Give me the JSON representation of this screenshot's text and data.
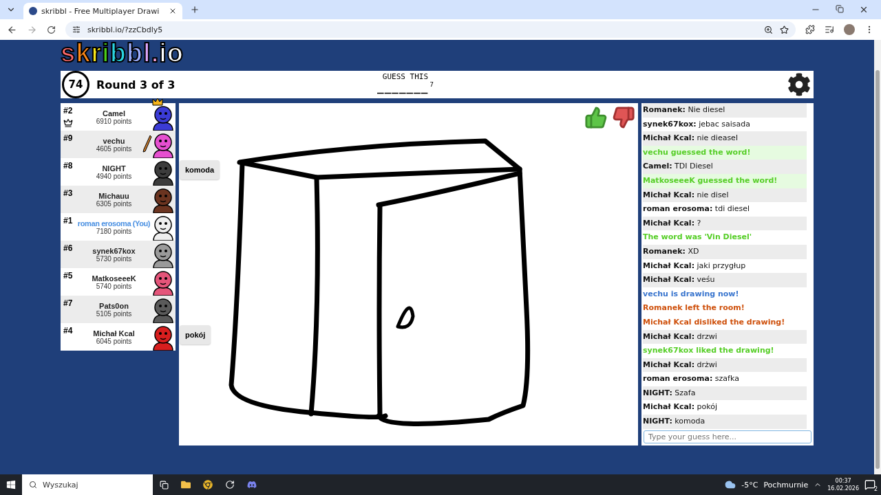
{
  "browser": {
    "tab_title": "skribbl - Free Multiplayer Drawi",
    "url": "skribbl.io/?zzCbdly5"
  },
  "logo": {
    "text": "skribbl.io"
  },
  "header": {
    "timer": "74",
    "round": "Round 3 of 3",
    "prompt": "GUESS THIS",
    "hint": "_______",
    "hint_length": "7"
  },
  "players": [
    {
      "rank": "#2",
      "name": "Camel",
      "points": "6910 points",
      "color": "#3b3bd6",
      "owner": true,
      "crowned": true,
      "drawing": false,
      "you": false
    },
    {
      "rank": "#9",
      "name": "vechu",
      "points": "4605 points",
      "color": "#e64fd0",
      "owner": false,
      "crowned": false,
      "drawing": true,
      "you": false
    },
    {
      "rank": "#8",
      "name": "NIGHT",
      "points": "4940 points",
      "color": "#3c3c3c",
      "owner": false,
      "crowned": false,
      "drawing": false,
      "you": false,
      "bubble": "komoda"
    },
    {
      "rank": "#3",
      "name": "Michauu",
      "points": "6305 points",
      "color": "#6b3420",
      "owner": false,
      "crowned": false,
      "drawing": false,
      "you": false
    },
    {
      "rank": "#1",
      "name": "roman erosoma (You)",
      "points": "7180 points",
      "color": "#eeeeee",
      "owner": false,
      "crowned": false,
      "drawing": false,
      "you": true
    },
    {
      "rank": "#6",
      "name": "synek67kox",
      "points": "5730 points",
      "color": "#9a9a9a",
      "owner": false,
      "crowned": false,
      "drawing": false,
      "you": false
    },
    {
      "rank": "#5",
      "name": "MatkoseeeK",
      "points": "5740 points",
      "color": "#e4557a",
      "owner": false,
      "crowned": false,
      "drawing": false,
      "you": false
    },
    {
      "rank": "#7",
      "name": "Pats0on",
      "points": "5105 points",
      "color": "#5a5a5a",
      "owner": false,
      "crowned": false,
      "drawing": false,
      "you": false
    },
    {
      "rank": "#4",
      "name": "Michał Kcal",
      "points": "6045 points",
      "color": "#d81e1e",
      "owner": false,
      "crowned": false,
      "drawing": false,
      "you": false,
      "bubble": "pokój"
    }
  ],
  "chat": {
    "messages": [
      {
        "kind": "message",
        "author": "Romanek:",
        "text": "Nie diesel"
      },
      {
        "kind": "message",
        "author": "synek67kox:",
        "text": "jebac saisada"
      },
      {
        "kind": "message",
        "author": "Michał Kcal:",
        "text": "nie dieasel"
      },
      {
        "kind": "guessed",
        "text": "vechu guessed the word!"
      },
      {
        "kind": "message",
        "author": "Camel:",
        "text": "TDI Diesel"
      },
      {
        "kind": "guessed",
        "text": "MatkoseeeK guessed the word!"
      },
      {
        "kind": "message",
        "author": "Michał Kcal:",
        "text": "nie disel"
      },
      {
        "kind": "message",
        "author": "roman erosoma:",
        "text": "tdi diesel"
      },
      {
        "kind": "message",
        "author": "Michał Kcal:",
        "text": "?"
      },
      {
        "kind": "success",
        "text": "The word was 'Vin Diesel'"
      },
      {
        "kind": "message",
        "author": "Romanek:",
        "text": "XD"
      },
      {
        "kind": "message",
        "author": "Michał Kcal:",
        "text": "jaki przygłup"
      },
      {
        "kind": "message",
        "author": "Michał Kcal:",
        "text": "veśu"
      },
      {
        "kind": "info",
        "text": "vechu is drawing now!"
      },
      {
        "kind": "warning",
        "text": "Romanek left the room!"
      },
      {
        "kind": "warning",
        "text": "Michał Kcal disliked the drawing!"
      },
      {
        "kind": "message",
        "author": "Michał Kcal:",
        "text": "drzwi"
      },
      {
        "kind": "success",
        "text": "synek67kox liked the drawing!"
      },
      {
        "kind": "message",
        "author": "Michał Kcal:",
        "text": "drżwi"
      },
      {
        "kind": "message",
        "author": "roman erosoma:",
        "text": "szafka"
      },
      {
        "kind": "message",
        "author": "NIGHT:",
        "text": "Szafa"
      },
      {
        "kind": "message",
        "author": "Michał Kcal:",
        "text": "pokój"
      },
      {
        "kind": "message",
        "author": "NIGHT:",
        "text": "komoda"
      }
    ],
    "placeholder": "Type your guess here..."
  },
  "taskbar": {
    "search": "Wyszukaj",
    "temperature": "-5°C",
    "weather": "Pochmurnie",
    "time": "00:37",
    "date": "16.02.2026",
    "notifications": "2"
  }
}
